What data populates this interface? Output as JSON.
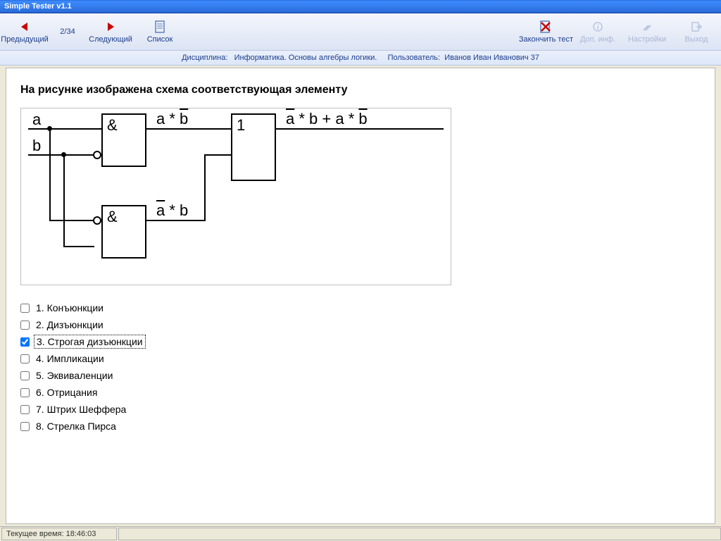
{
  "window": {
    "title": "Simple Tester v1.1"
  },
  "toolbar": {
    "prev": "Предыдущий",
    "counter": "2/34",
    "next": "Следующий",
    "list": "Список",
    "finish": "Закончить тест",
    "info": "Доп. инф.",
    "settings": "Настройки",
    "exit": "Выход"
  },
  "infobar": {
    "discipline_label": "Дисциплина:",
    "discipline": "Информатика. Основы алгебры логики.",
    "user_label": "Пользователь:",
    "user": "Иванов Иван Иванович  37"
  },
  "question": "На рисунке изображена схема соответствующая элементу",
  "diagram": {
    "input_a": "a",
    "input_b": "b",
    "gate1_sym": "&",
    "gate1_out": "a * b̄",
    "gate2_sym": "&",
    "gate2_out": "ā * b",
    "gate3_sym": "1",
    "output": "ā * b + a * b̄"
  },
  "answers": [
    {
      "n": "1.",
      "text": "Конъюнкции",
      "checked": false
    },
    {
      "n": "2.",
      "text": "Дизъюнкции",
      "checked": false
    },
    {
      "n": "3.",
      "text": "Строгая дизъюнкции",
      "checked": true
    },
    {
      "n": "4.",
      "text": "Импликации",
      "checked": false
    },
    {
      "n": "5.",
      "text": "Эквиваленции",
      "checked": false
    },
    {
      "n": "6.",
      "text": "Отрицания",
      "checked": false
    },
    {
      "n": "7.",
      "text": "Штрих Шеффера",
      "checked": false
    },
    {
      "n": "8.",
      "text": "Стрелка Пирса",
      "checked": false
    }
  ],
  "statusbar": {
    "time_label": "Текущее время:",
    "time": "18:46:03"
  }
}
